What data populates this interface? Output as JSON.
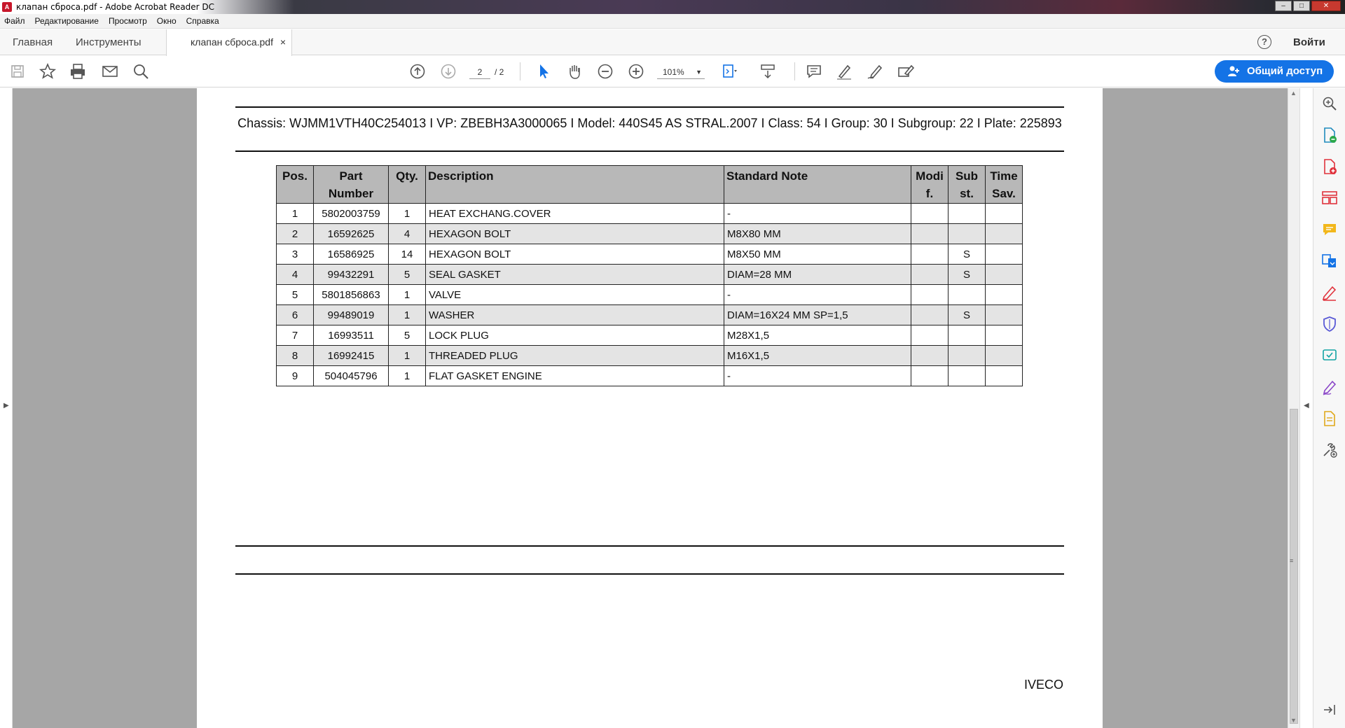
{
  "window": {
    "title": "клапан сброса.pdf - Adobe Acrobat Reader DC"
  },
  "menu": [
    "Файл",
    "Редактирование",
    "Просмотр",
    "Окно",
    "Справка"
  ],
  "tabs": {
    "home": "Главная",
    "tools": "Инструменты",
    "document": "клапан сброса.pdf",
    "close": "×"
  },
  "header": {
    "help": "?",
    "sign_in": "Войти"
  },
  "toolbar": {
    "page_current": "2",
    "page_total": "/ 2",
    "zoom": "101%",
    "share_label": "Общий доступ",
    "accent_color": "#1473e6"
  },
  "document": {
    "chassis_line": "Chassis: WJMM1VTH40C254013 I VP: ZBEBH3A3000065 I Model: 440S45 AS STRAL.2007 I Class: 54 I Group: 30 I Subgroup: 22 I Plate: 225893",
    "table": {
      "headers": {
        "pos": "Pos.",
        "part_number": "Part Number",
        "qty": "Qty.",
        "description": "Description",
        "standard_note": "Standard Note",
        "modif": "Modi f.",
        "subst": "Sub st.",
        "time_sav": "Time Sav."
      },
      "rows": [
        {
          "pos": "1",
          "part": "5802003759",
          "qty": "1",
          "desc": "HEAT EXCHANG.COVER",
          "note": "-",
          "modif": "",
          "subst": "",
          "time": ""
        },
        {
          "pos": "2",
          "part": "16592625",
          "qty": "4",
          "desc": "HEXAGON BOLT",
          "note": "M8X80 MM",
          "modif": "",
          "subst": "",
          "time": ""
        },
        {
          "pos": "3",
          "part": "16586925",
          "qty": "14",
          "desc": "HEXAGON BOLT",
          "note": "M8X50 MM",
          "modif": "",
          "subst": "S",
          "time": ""
        },
        {
          "pos": "4",
          "part": "99432291",
          "qty": "5",
          "desc": "SEAL GASKET",
          "note": "DIAM=28 MM",
          "modif": "",
          "subst": "S",
          "time": ""
        },
        {
          "pos": "5",
          "part": "5801856863",
          "qty": "1",
          "desc": "VALVE",
          "note": "-",
          "modif": "",
          "subst": "",
          "time": ""
        },
        {
          "pos": "6",
          "part": "99489019",
          "qty": "1",
          "desc": "WASHER",
          "note": "DIAM=16X24 MM SP=1,5",
          "modif": "",
          "subst": "S",
          "time": ""
        },
        {
          "pos": "7",
          "part": "16993511",
          "qty": "5",
          "desc": "LOCK PLUG",
          "note": "M28X1,5",
          "modif": "",
          "subst": "",
          "time": ""
        },
        {
          "pos": "8",
          "part": "16992415",
          "qty": "1",
          "desc": "THREADED PLUG",
          "note": "M16X1,5",
          "modif": "",
          "subst": "",
          "time": ""
        },
        {
          "pos": "9",
          "part": "504045796",
          "qty": "1",
          "desc": "FLAT GASKET ENGINE",
          "note": "-",
          "modif": "",
          "subst": "",
          "time": ""
        }
      ]
    },
    "footer_brand": "IVECO"
  }
}
